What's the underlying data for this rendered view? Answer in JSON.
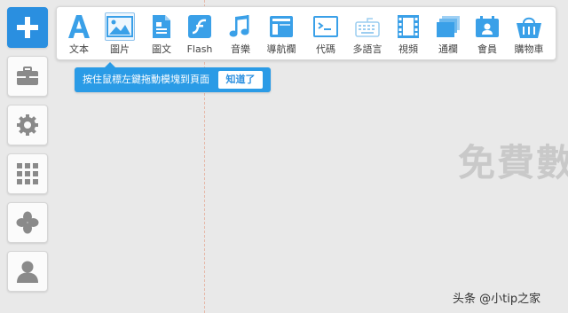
{
  "background_heading": "免費數",
  "palette": {
    "items": [
      {
        "label": "文本",
        "icon": "text-icon"
      },
      {
        "label": "圖片",
        "icon": "image-icon"
      },
      {
        "label": "圖文",
        "icon": "image-text-icon"
      },
      {
        "label": "Flash",
        "icon": "flash-icon"
      },
      {
        "label": "音樂",
        "icon": "music-icon"
      },
      {
        "label": "導航欄",
        "icon": "navbar-icon"
      },
      {
        "label": "代碼",
        "icon": "code-icon"
      },
      {
        "label": "多語言",
        "icon": "keyboard-icon"
      },
      {
        "label": "視頻",
        "icon": "video-icon"
      },
      {
        "label": "通欄",
        "icon": "banner-icon"
      },
      {
        "label": "會員",
        "icon": "member-icon"
      },
      {
        "label": "購物車",
        "icon": "cart-icon"
      }
    ],
    "active_label": "圖片"
  },
  "tooltip": {
    "message": "按住鼠標左鍵拖動模塊到頁面",
    "button_label": "知道了"
  },
  "sidebar": {
    "items": [
      {
        "icon": "plus-icon"
      },
      {
        "icon": "toolbox-icon"
      },
      {
        "icon": "gear-icon"
      },
      {
        "icon": "grid-icon"
      },
      {
        "icon": "clover-icon"
      },
      {
        "icon": "user-icon"
      }
    ]
  },
  "watermark": "头条 @小tip之家",
  "colors": {
    "accent": "#2a8fe0",
    "icon_blue": "#3aa0e8",
    "sidebar_icon": "#8a8a8a",
    "background": "#e9e9e9"
  }
}
